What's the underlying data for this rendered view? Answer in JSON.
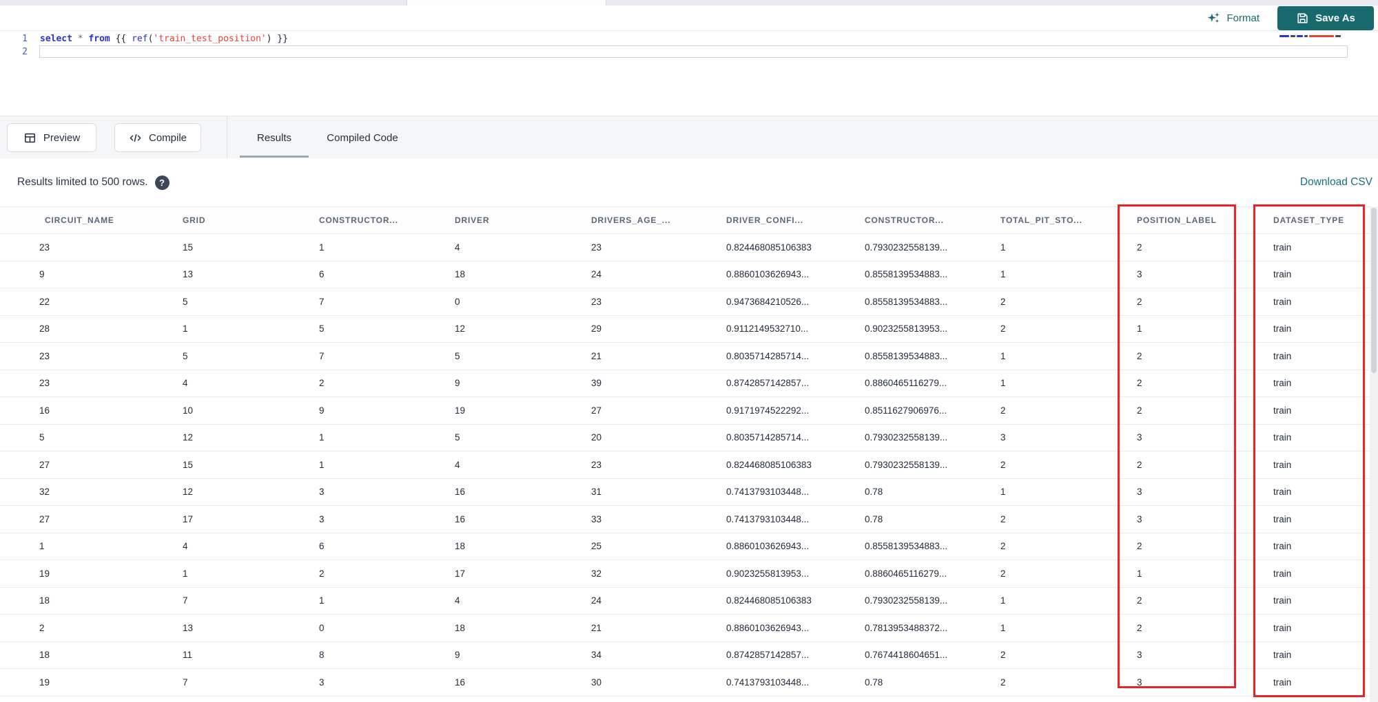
{
  "action_bar": {
    "format_label": "Format",
    "save_as_label": "Save As"
  },
  "editor": {
    "line_numbers": [
      "1",
      "2"
    ],
    "code_tokens": [
      {
        "t": "select",
        "c": "kw"
      },
      {
        "t": " ",
        "c": "pl"
      },
      {
        "t": "*",
        "c": "op"
      },
      {
        "t": " ",
        "c": "pl"
      },
      {
        "t": "from",
        "c": "kw"
      },
      {
        "t": " {{ ",
        "c": "pl"
      },
      {
        "t": "ref",
        "c": "fn"
      },
      {
        "t": "(",
        "c": "pl"
      },
      {
        "t": "'train_test_position'",
        "c": "str"
      },
      {
        "t": ")",
        "c": "pl"
      },
      {
        "t": " }}",
        "c": "pl"
      }
    ],
    "code_text": "select * from {{ ref('train_test_position') }}"
  },
  "panel": {
    "preview_label": "Preview",
    "compile_label": "Compile",
    "tabs": [
      {
        "label": "Results",
        "active": true
      },
      {
        "label": "Compiled Code",
        "active": false
      }
    ]
  },
  "results": {
    "limit_notice": "Results limited to 500 rows.",
    "help_glyph": "?",
    "download_label": "Download CSV"
  },
  "table": {
    "columns": [
      "CIRCUIT_NAME",
      "GRID",
      "CONSTRUCTOR...",
      "DRIVER",
      "DRIVERS_AGE_...",
      "DRIVER_CONFI...",
      "CONSTRUCTOR...",
      "TOTAL_PIT_STO...",
      "POSITION_LABEL",
      "DATASET_TYPE"
    ],
    "rows": [
      [
        "23",
        "15",
        "1",
        "4",
        "23",
        "0.824468085106383",
        "0.7930232558139...",
        "1",
        "2",
        "train"
      ],
      [
        "9",
        "13",
        "6",
        "18",
        "24",
        "0.8860103626943...",
        "0.8558139534883...",
        "1",
        "3",
        "train"
      ],
      [
        "22",
        "5",
        "7",
        "0",
        "23",
        "0.9473684210526...",
        "0.8558139534883...",
        "2",
        "2",
        "train"
      ],
      [
        "28",
        "1",
        "5",
        "12",
        "29",
        "0.9112149532710...",
        "0.9023255813953...",
        "2",
        "1",
        "train"
      ],
      [
        "23",
        "5",
        "7",
        "5",
        "21",
        "0.8035714285714...",
        "0.8558139534883...",
        "1",
        "2",
        "train"
      ],
      [
        "23",
        "4",
        "2",
        "9",
        "39",
        "0.8742857142857...",
        "0.8860465116279...",
        "1",
        "2",
        "train"
      ],
      [
        "16",
        "10",
        "9",
        "19",
        "27",
        "0.9171974522292...",
        "0.8511627906976...",
        "2",
        "2",
        "train"
      ],
      [
        "5",
        "12",
        "1",
        "5",
        "20",
        "0.8035714285714...",
        "0.7930232558139...",
        "3",
        "3",
        "train"
      ],
      [
        "27",
        "15",
        "1",
        "4",
        "23",
        "0.824468085106383",
        "0.7930232558139...",
        "2",
        "2",
        "train"
      ],
      [
        "32",
        "12",
        "3",
        "16",
        "31",
        "0.7413793103448...",
        "0.78",
        "1",
        "3",
        "train"
      ],
      [
        "27",
        "17",
        "3",
        "16",
        "33",
        "0.7413793103448...",
        "0.78",
        "2",
        "3",
        "train"
      ],
      [
        "1",
        "4",
        "6",
        "18",
        "25",
        "0.8860103626943...",
        "0.8558139534883...",
        "2",
        "2",
        "train"
      ],
      [
        "19",
        "1",
        "2",
        "17",
        "32",
        "0.9023255813953...",
        "0.8860465116279...",
        "2",
        "1",
        "train"
      ],
      [
        "18",
        "7",
        "1",
        "4",
        "24",
        "0.824468085106383",
        "0.7930232558139...",
        "1",
        "2",
        "train"
      ],
      [
        "2",
        "13",
        "0",
        "18",
        "21",
        "0.8860103626943...",
        "0.7813953488372...",
        "1",
        "2",
        "train"
      ],
      [
        "18",
        "11",
        "8",
        "9",
        "34",
        "0.8742857142857...",
        "0.7674418604651...",
        "2",
        "3",
        "train"
      ],
      [
        "19",
        "7",
        "3",
        "16",
        "30",
        "0.7413793103448...",
        "0.78",
        "2",
        "3",
        "train"
      ]
    ]
  },
  "annotations": {
    "highlight_color": "#e8232a",
    "highlighted_columns": [
      "POSITION_LABEL",
      "DATASET_TYPE"
    ]
  },
  "colors": {
    "accent_teal": "#17696e",
    "link_teal": "#17707e",
    "keyword_blue": "#2a33cc",
    "string_red": "#e0443a"
  }
}
